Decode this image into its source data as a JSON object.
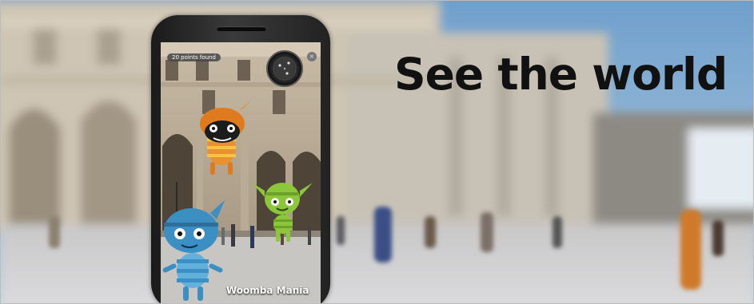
{
  "headline": "See the world",
  "phone": {
    "points_badge": "20 points found",
    "close_glyph": "×",
    "app_name": "Woomba Mania"
  },
  "colors": {
    "sky": "#7ea8cc",
    "stone": "#cfc6b8",
    "creature_orange": "#e07a1e",
    "creature_green": "#8cc63a",
    "creature_blue": "#3c8fc2"
  },
  "icons": [
    "radar-icon",
    "close-icon"
  ]
}
